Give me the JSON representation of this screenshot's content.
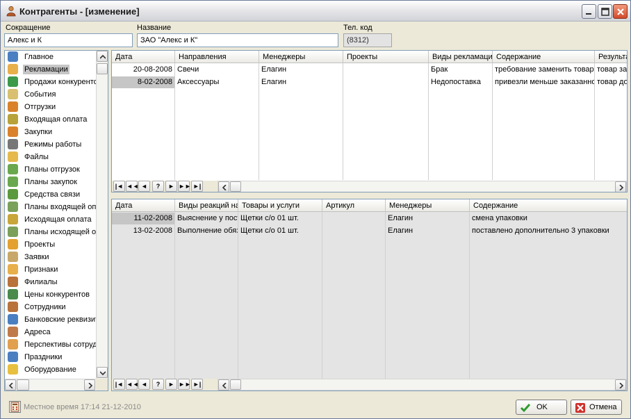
{
  "window": {
    "title": "Контрагенты - [изменение]",
    "icon": "person-icon"
  },
  "header": {
    "short_label": "Сокращение",
    "short_value": "Алекс и К",
    "name_label": "Название",
    "name_value": "ЗАО \"Алекс и К\"",
    "phone_label": "Тел. код",
    "phone_value": "(8312)"
  },
  "sidebar": {
    "items": [
      {
        "label": "Главное",
        "icon": "document-icon",
        "color": "#4a7fc1"
      },
      {
        "label": "Рекламации",
        "icon": "pencil-note-icon",
        "color": "#e8b04a",
        "selected": true
      },
      {
        "label": "Продажи конкурентов",
        "icon": "globe-icon",
        "color": "#3c9a4a"
      },
      {
        "label": "События",
        "icon": "notepad-icon",
        "color": "#d8c070"
      },
      {
        "label": "Отгрузки",
        "icon": "truck-icon",
        "color": "#d9822b"
      },
      {
        "label": "Входящая оплата",
        "icon": "money-in-icon",
        "color": "#b8a23a"
      },
      {
        "label": "Закупки",
        "icon": "cart-icon",
        "color": "#d9822b"
      },
      {
        "label": "Режимы работы",
        "icon": "clock-icon",
        "color": "#777777"
      },
      {
        "label": "Файлы",
        "icon": "folder-icon",
        "color": "#e5b94c"
      },
      {
        "label": "Планы отгрузок",
        "icon": "ship-plan-icon",
        "color": "#6aa84f"
      },
      {
        "label": "Планы закупок",
        "icon": "buy-plan-icon",
        "color": "#6aa84f"
      },
      {
        "label": "Средства связи",
        "icon": "phone-icon",
        "color": "#5b9a3c"
      },
      {
        "label": "Планы входящей оплаты",
        "icon": "income-plan-icon",
        "color": "#7aa05a"
      },
      {
        "label": "Исходящая оплата",
        "icon": "money-out-icon",
        "color": "#c9a63a"
      },
      {
        "label": "Планы исходящей оплаты",
        "icon": "outcome-plan-icon",
        "color": "#7aa05a"
      },
      {
        "label": "Проекты",
        "icon": "project-icon",
        "color": "#e3a12f"
      },
      {
        "label": "Заявки",
        "icon": "request-icon",
        "color": "#c8a86a"
      },
      {
        "label": "Признаки",
        "icon": "box-icon",
        "color": "#e8b04a"
      },
      {
        "label": "Филиалы",
        "icon": "branch-person-icon",
        "color": "#b8723a"
      },
      {
        "label": "Цены конкурентов",
        "icon": "price-icon",
        "color": "#4a8a4a"
      },
      {
        "label": "Сотрудники",
        "icon": "people-icon",
        "color": "#b8723a"
      },
      {
        "label": "Банковские реквизиты",
        "icon": "bank-icon",
        "color": "#4a7fc1"
      },
      {
        "label": "Адреса",
        "icon": "address-icon",
        "color": "#c07a4a"
      },
      {
        "label": "Перспективы сотрудничества",
        "icon": "handshake-icon",
        "color": "#e0a050"
      },
      {
        "label": "Праздники",
        "icon": "calendar-icon",
        "color": "#4a7fc1"
      },
      {
        "label": "Оборудование",
        "icon": "equipment-icon",
        "color": "#e8c040"
      }
    ]
  },
  "claims_grid": {
    "columns": [
      "Дата",
      "Направления",
      "Менеджеры",
      "Проекты",
      "Виды рекламаций",
      "Содержание",
      "Результат"
    ],
    "rows": [
      [
        "20-08-2008",
        "Свечи",
        "Елагин",
        "",
        "Брак",
        "требование заменить товар",
        "товар заменен"
      ],
      [
        "8-02-2008",
        "Аксессуары",
        "Елагин",
        "",
        "Недопоставка",
        "привезли меньше заказанного",
        "товар довезен"
      ]
    ]
  },
  "reactions_grid": {
    "columns": [
      "Дата",
      "Виды реакций на рекламации",
      "Товары и услуги",
      "Артикул",
      "Менеджеры",
      "Содержание"
    ],
    "rows": [
      [
        "11-02-2008",
        "Выяснение у поставщика",
        "Щетки с/о 01 шт.",
        "",
        "Елагин",
        "смена упаковки"
      ],
      [
        "13-02-2008",
        "Выполнение обязательств",
        "Щетки с/о 01 шт.",
        "",
        "Елагин",
        "поставлено дополнительно 3 упаковки"
      ]
    ]
  },
  "navigator": {
    "first": "|◄",
    "prev_page": "◄◄",
    "prev": "◄",
    "help": "?",
    "next": "►",
    "next_page": "►►",
    "last": "►|"
  },
  "footer": {
    "time_text": "Местное время  17:14   21-12-2010",
    "ok_label": "OK",
    "cancel_label": "Отмена"
  }
}
